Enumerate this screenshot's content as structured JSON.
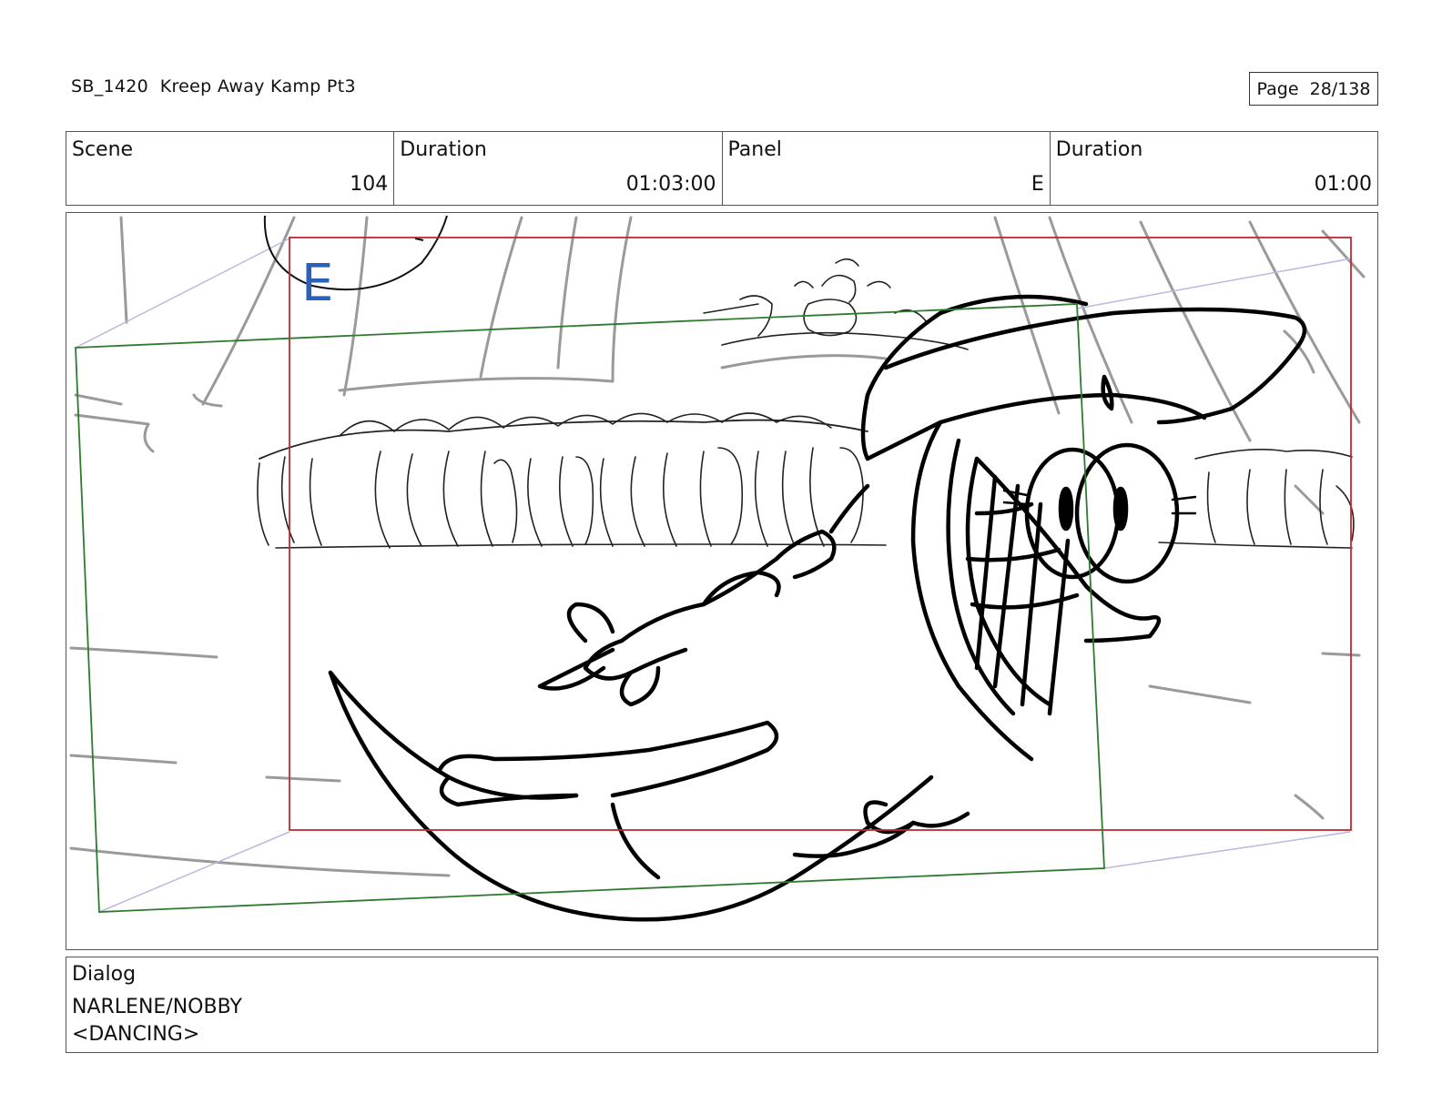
{
  "header": {
    "title": "SB_1420  Kreep Away Kamp Pt3",
    "page_label": "Page",
    "page_value": "28/138"
  },
  "info": {
    "scene_label": "Scene",
    "scene_value": "104",
    "scene_duration_label": "Duration",
    "scene_duration_value": "01:03:00",
    "panel_label": "Panel",
    "panel_value": "E",
    "panel_duration_label": "Duration",
    "panel_duration_value": "01:00"
  },
  "frame": {
    "panel_marker": "E",
    "colors": {
      "marker": "#2a62b8",
      "camera_red": "#c0282d",
      "camera_green": "#2f7a2f",
      "guide_lavender": "#b9b9e0",
      "sketch_grey": "#9a9a9a",
      "ink": "#000000"
    }
  },
  "dialog": {
    "label": "Dialog",
    "line1": "NARLENE/NOBBY",
    "line2": "<DANCING>"
  }
}
